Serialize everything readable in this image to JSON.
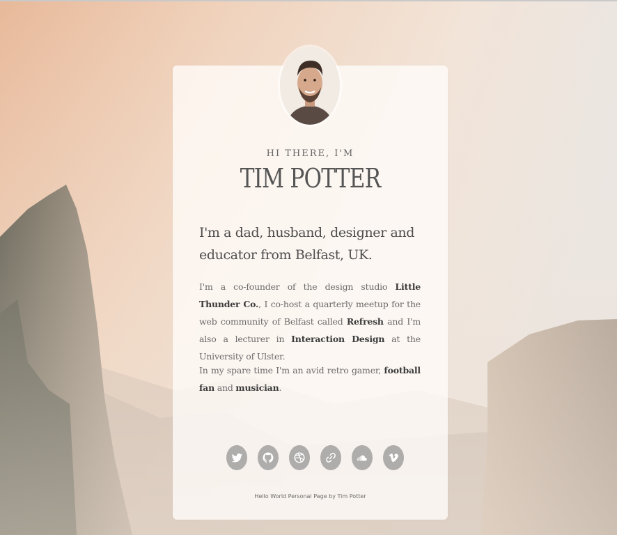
{
  "profile": {
    "greeting": "HI THERE, I'M",
    "name": "TIM POTTER",
    "lead": "I'm a dad, husband, designer and educator from Belfast, UK."
  },
  "bio": {
    "p1_a": "I'm a co-founder of the design studio ",
    "p1_studio": "Little Thunder Co.",
    "p1_b": ", I co-host a quarterly meetup for the web community of Belfast called ",
    "p1_meetup": "Refresh",
    "p1_c": " and I'm also a lecturer in ",
    "p1_subject": "Interaction Design",
    "p1_d": " at the University of Ulster.",
    "p2_a": "In my spare time I'm an avid retro gamer, ",
    "p2_football": "football fan",
    "p2_b": " and ",
    "p2_music": "musician",
    "p2_c": "."
  },
  "social": [
    {
      "icon": "twitter-icon"
    },
    {
      "icon": "github-icon"
    },
    {
      "icon": "dribbble-icon"
    },
    {
      "icon": "link-icon"
    },
    {
      "icon": "soundcloud-icon"
    },
    {
      "icon": "vimeo-icon"
    }
  ],
  "footer": {
    "text_a": "Hello World Personal Page",
    "text_by": " by ",
    "text_author": "Tim Potter"
  },
  "colors": {
    "card_bg": "#fffdfa",
    "icon_bg": "#969696",
    "text_dark": "#4e4e4e"
  }
}
